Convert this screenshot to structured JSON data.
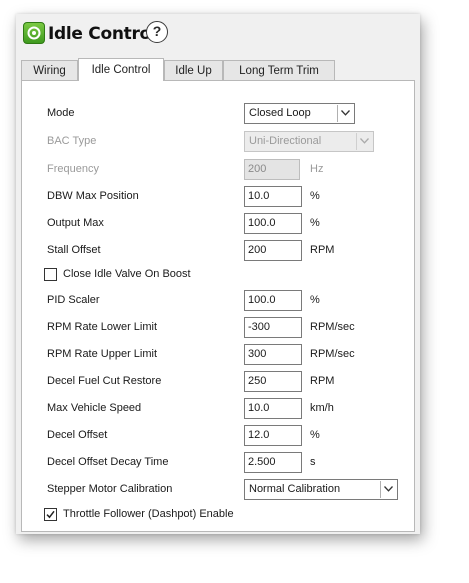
{
  "window": {
    "title": "Idle Control",
    "help_label": "?"
  },
  "tabs": [
    {
      "label": "Wiring"
    },
    {
      "label": "Idle Control"
    },
    {
      "label": "Idle Up"
    },
    {
      "label": "Long Term Trim"
    }
  ],
  "active_tab": "Idle Control",
  "form": {
    "mode": {
      "label": "Mode",
      "value": "Closed Loop"
    },
    "bac_type": {
      "label": "BAC Type",
      "value": "Uni-Directional",
      "disabled": true
    },
    "frequency": {
      "label": "Frequency",
      "value": "200",
      "unit": "Hz",
      "disabled": true
    },
    "dbw_max_position": {
      "label": "DBW Max Position",
      "value": "10.0",
      "unit": "%"
    },
    "output_max": {
      "label": "Output Max",
      "value": "100.0",
      "unit": "%"
    },
    "stall_offset": {
      "label": "Stall Offset",
      "value": "200",
      "unit": "RPM"
    },
    "close_idle_valve_on_boost": {
      "label": "Close Idle Valve On Boost",
      "checked": false
    },
    "pid_scaler": {
      "label": "PID Scaler",
      "value": "100.0",
      "unit": "%"
    },
    "rpm_rate_lower_limit": {
      "label": "RPM Rate Lower Limit",
      "value": "-300",
      "unit": "RPM/sec"
    },
    "rpm_rate_upper_limit": {
      "label": "RPM Rate Upper Limit",
      "value": "300",
      "unit": "RPM/sec"
    },
    "decel_fuel_cut_restore": {
      "label": "Decel Fuel Cut Restore",
      "value": "250",
      "unit": "RPM"
    },
    "max_vehicle_speed": {
      "label": "Max Vehicle Speed",
      "value": "10.0",
      "unit": "km/h"
    },
    "decel_offset": {
      "label": "Decel Offset",
      "value": "12.0",
      "unit": "%"
    },
    "decel_offset_decay_time": {
      "label": "Decel Offset Decay Time",
      "value": "2.500",
      "unit": "s"
    },
    "stepper_motor_calibration": {
      "label": "Stepper Motor Calibration",
      "value": "Normal Calibration"
    },
    "throttle_follower_enable": {
      "label": "Throttle Follower (Dashpot) Enable",
      "checked": true
    }
  },
  "icons": {
    "app": "app-logo-icon",
    "help": "help-icon",
    "dropdown": "chevron-down-icon",
    "check": "check-icon"
  },
  "colors": {
    "app_icon": "#5cb52f",
    "panel_bg": "#ffffff",
    "window_bg": "#f0f0f0",
    "disabled_text": "#9a9a9a"
  }
}
